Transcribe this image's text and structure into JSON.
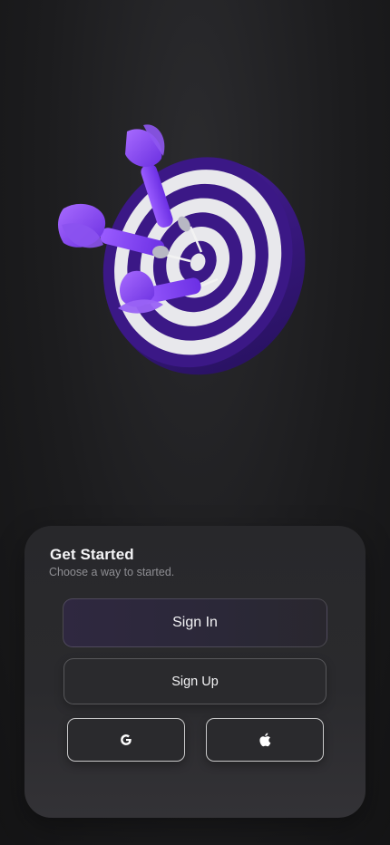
{
  "card": {
    "title": "Get Started",
    "subtitle": "Choose a way to started."
  },
  "buttons": {
    "sign_in_label": "Sign In",
    "sign_up_label": "Sign Up",
    "google_icon": "google-g-icon",
    "apple_icon": "apple-logo-icon"
  },
  "colors": {
    "accent_purple": "#7b3ff2",
    "board_dark": "#3a1680",
    "board_light": "#e6e6ea",
    "background": "#1c1c1e"
  }
}
